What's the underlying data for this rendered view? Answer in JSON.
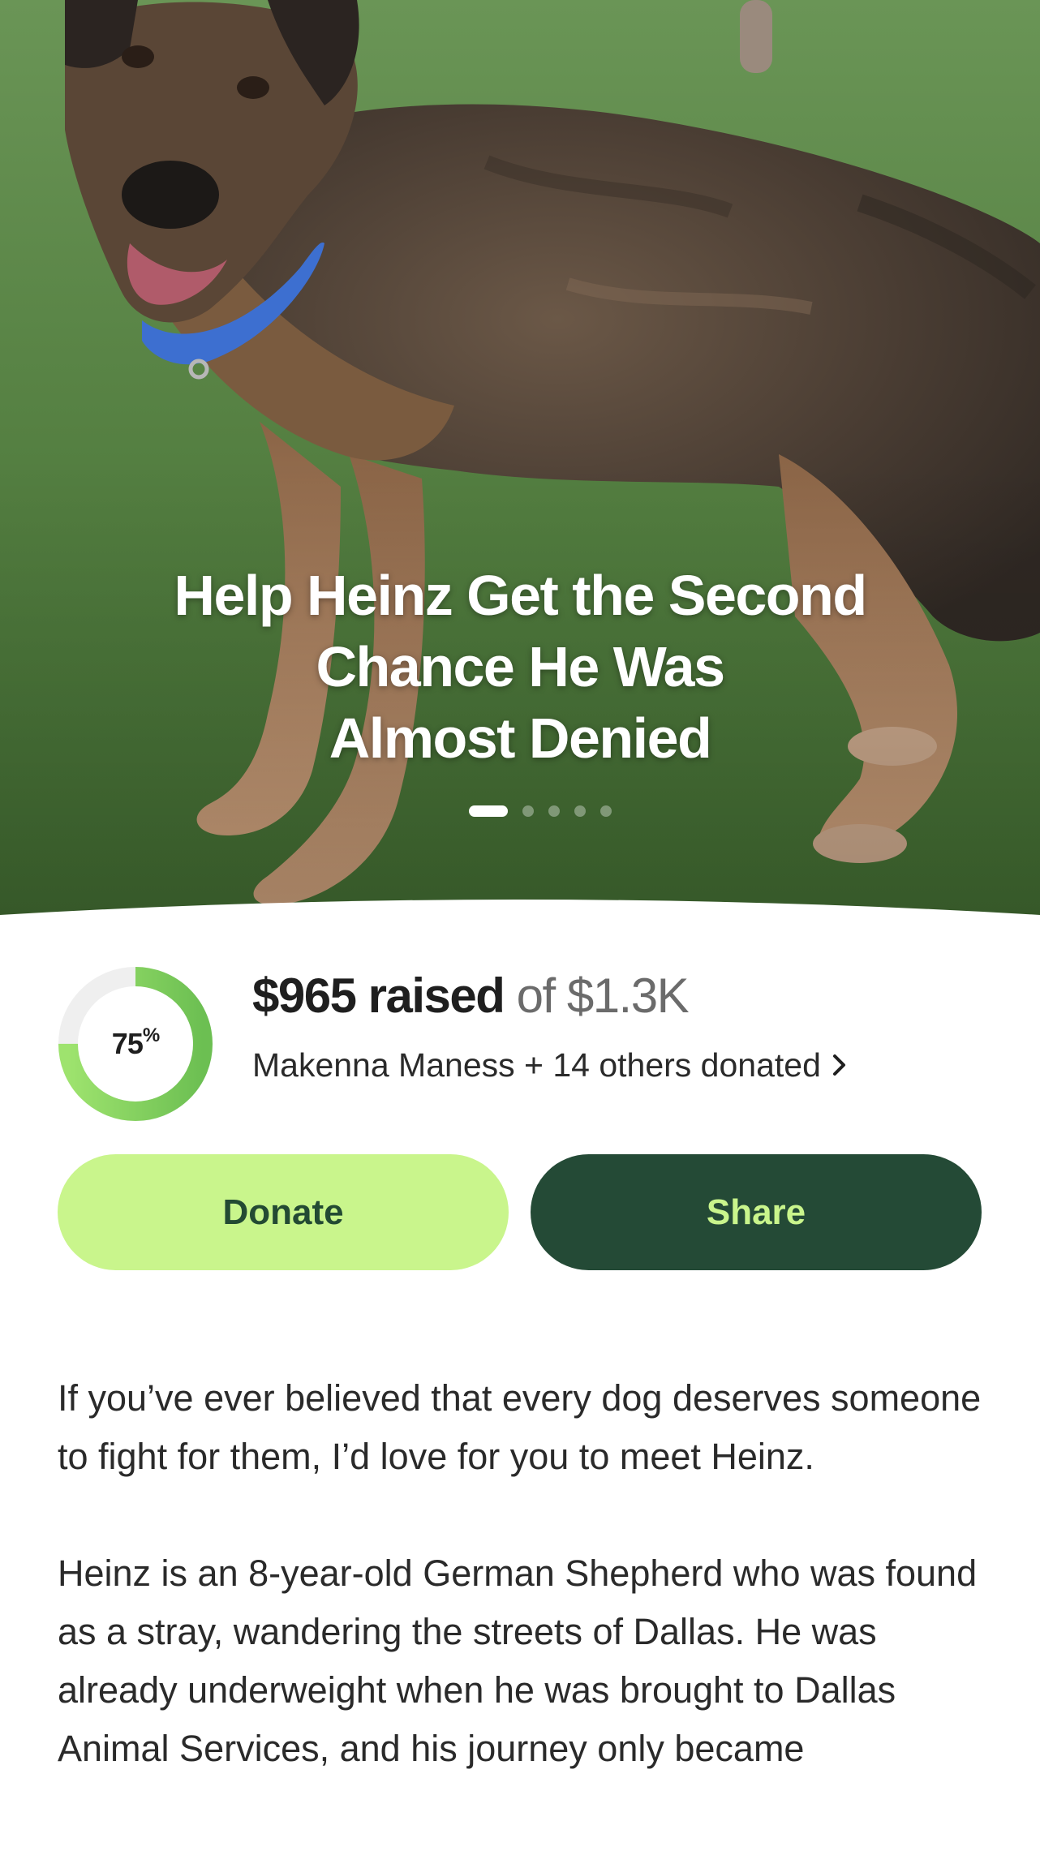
{
  "hero": {
    "title_line1": "Help Heinz Get the Second",
    "title_line2": "Chance He Was",
    "title_line3": "Almost Denied",
    "image": "photo of a German Shepherd dog with a blue collar standing on green turf",
    "carousel": {
      "total": 5,
      "active_index": 0
    }
  },
  "progress": {
    "percent": 75,
    "percent_label": "75",
    "percent_sign": "%",
    "ring_color": "#7ccb5b",
    "track_color": "#eeeeee"
  },
  "fundraiser": {
    "raised_amount": "$965 raised",
    "goal_text": "of $1.3K",
    "donors_text": "Makenna Maness + 14 others donated"
  },
  "actions": {
    "donate_label": "Donate",
    "share_label": "Share",
    "donate_color": "#c9f58c",
    "share_color": "#244a36"
  },
  "story": {
    "paragraph1": "If you’ve ever believed that every dog deserves someone to fight for them, I’d love for you to meet Heinz.",
    "paragraph2": "Heinz is an 8-year-old German Shepherd who was found as a stray, wandering the streets of Dallas. He was already underweight when he was brought to Dallas Animal Services, and his journey only became"
  }
}
